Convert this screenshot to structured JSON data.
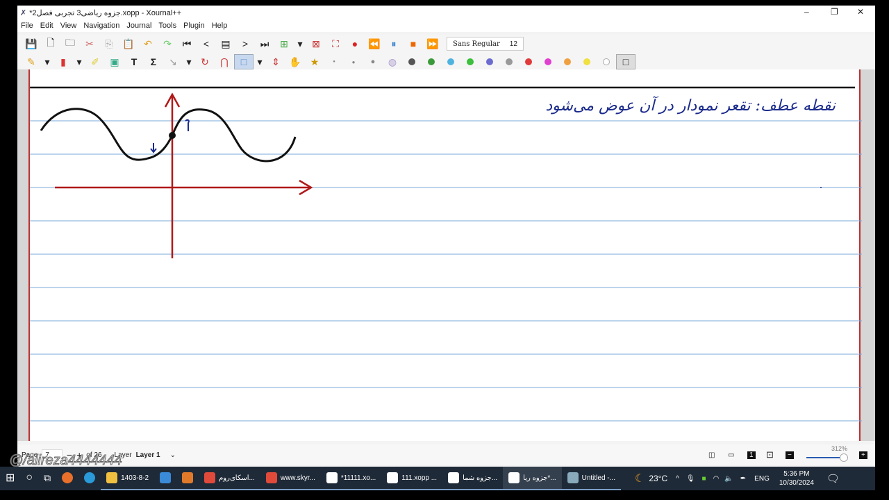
{
  "window": {
    "title": "*2جزوه ریاضی3 تجربی فصل.xopp - Xournal++",
    "minimize": "–",
    "maximize": "❐",
    "close": "✕"
  },
  "menu": [
    "File",
    "Edit",
    "View",
    "Navigation",
    "Journal",
    "Tools",
    "Plugin",
    "Help"
  ],
  "font": {
    "name": "Sans Regular",
    "size": "12"
  },
  "colors": [
    "#555555",
    "#3a9a3a",
    "#4fb3e0",
    "#3cbf3c",
    "#6b6bd0",
    "#999999",
    "#e03a3a",
    "#e040d0",
    "#f0a040",
    "#f0e040",
    "#ffffff"
  ],
  "note": {
    "text": "نقطه عطف: تقعر نمودار در آن عوض می‌شود"
  },
  "status": {
    "page_label": "Page",
    "page_value": "7",
    "minus": "−",
    "plus": "+",
    "of": "of 26",
    "layer_label": "Layer",
    "layer_value": "Layer 1",
    "zoom": "312%"
  },
  "watermark": "@/alireza4444444",
  "taskbar": {
    "items": [
      {
        "label": "1403-8-2",
        "color": "#f0c040"
      },
      {
        "label": "",
        "color": "#3a8ad8"
      },
      {
        "label": "",
        "color": "#e07a2a"
      },
      {
        "label": "اسکای‌روم...",
        "color": "#e04a3a"
      },
      {
        "label": "www.skyr...",
        "color": "#e04a3a"
      },
      {
        "label": "*11111.xo...",
        "color": "#ffffff"
      },
      {
        "label": "111.xopp ...",
        "color": "#ffffff"
      },
      {
        "label": "جزوه شما...",
        "color": "#ffffff"
      },
      {
        "label": "جزوه ریا*...",
        "color": "#ffffff"
      },
      {
        "label": "Untitled -...",
        "color": "#8ab"
      }
    ],
    "temp": "23°C",
    "lang": "ENG",
    "time": "5:36 PM",
    "date": "10/30/2024"
  }
}
